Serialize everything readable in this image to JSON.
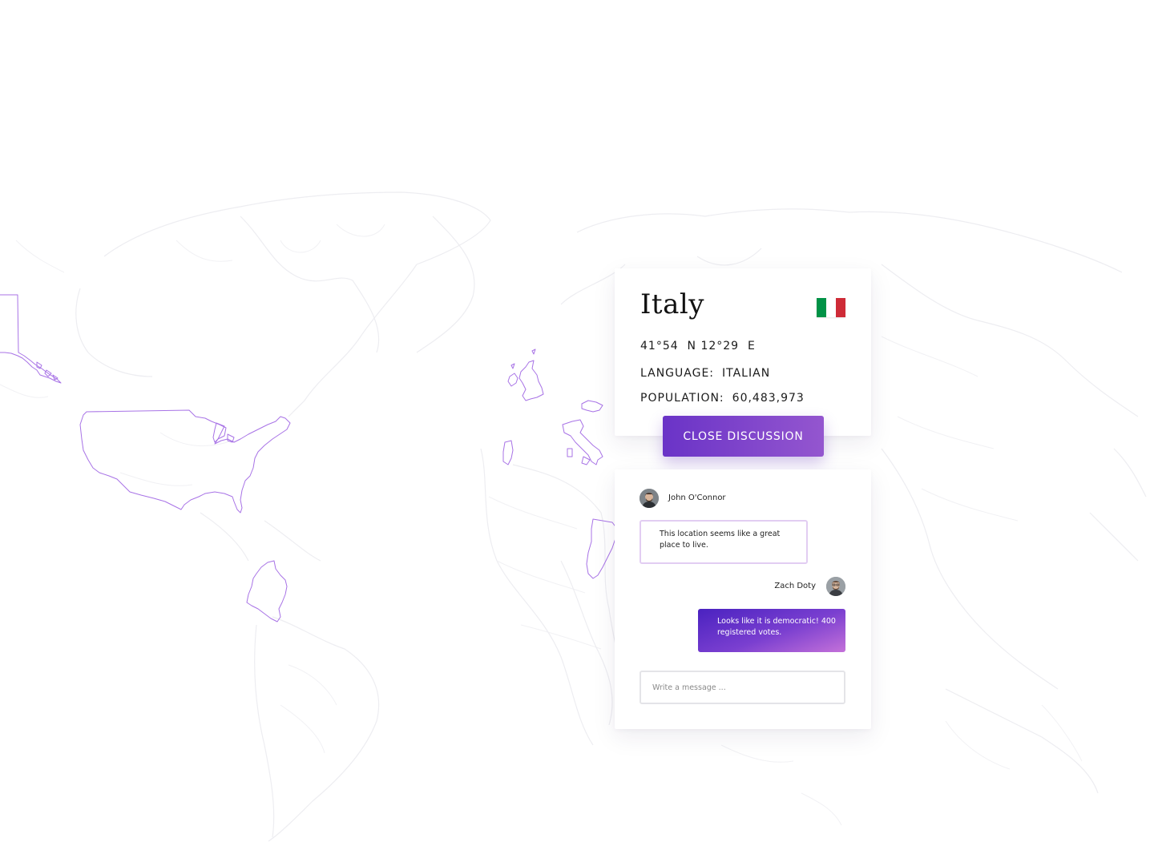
{
  "country": {
    "name": "Italy",
    "flag_colors": [
      "#009246",
      "#ffffff",
      "#ce2b37"
    ],
    "coordinates": "41°54  N 12°29  E",
    "language_label": "LANGUAGE:",
    "language_value": "ITALIAN",
    "population_label": "POPULATION:",
    "population_value": "60,483,973"
  },
  "actions": {
    "close_discussion_label": "CLOSE DISCUSSION"
  },
  "chat": {
    "messages": [
      {
        "author": "John O'Connor",
        "text": "This location seems like a great place to live."
      },
      {
        "author": "Zach Doty",
        "text": "Looks like it is democratic! 400 registered votes."
      }
    ],
    "input_placeholder": "Write a message ..."
  },
  "theme": {
    "accent": "#6a33c7",
    "accent_gradient_end": "#c471d9",
    "map_outline": "#ededf1",
    "map_highlight": "#a873e6"
  }
}
